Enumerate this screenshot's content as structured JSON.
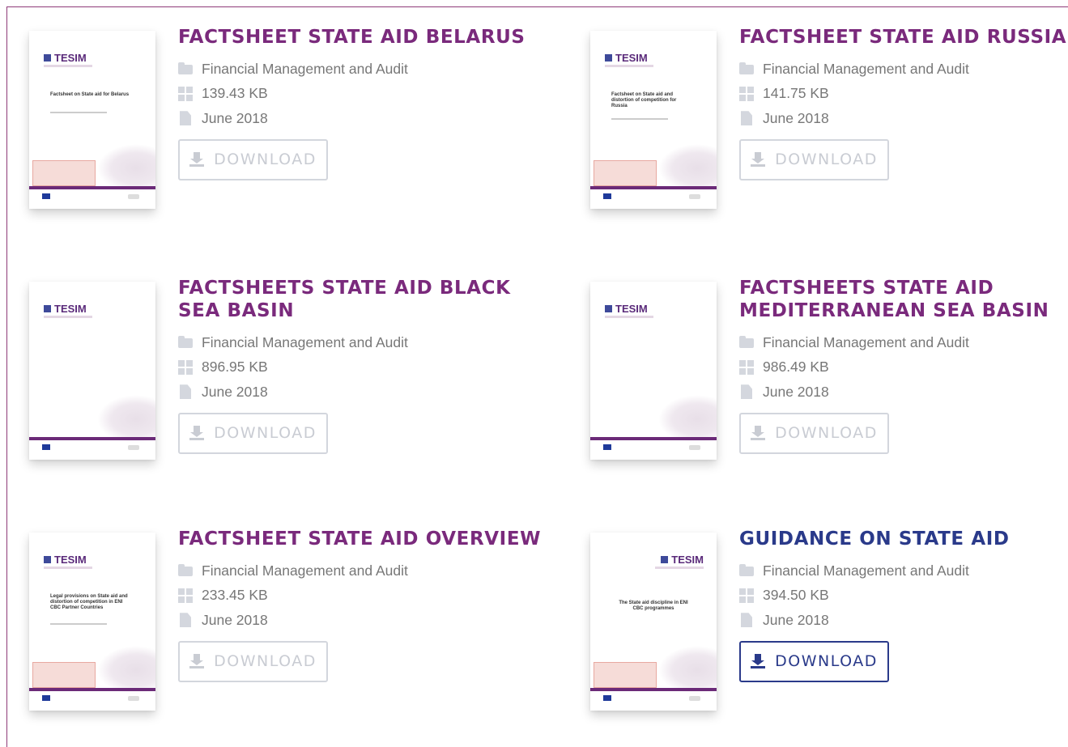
{
  "documents": [
    {
      "title": "FACTSHEET STATE AID BELARUS",
      "category": "Financial Management and Audit",
      "size": "139.43 KB",
      "date": "June 2018",
      "download_label": "DOWNLOAD",
      "thumb_logo": "TESIM",
      "thumb_title": "Factsheet on State aid for Belarus"
    },
    {
      "title": "FACTSHEET STATE AID RUSSIA",
      "category": "Financial Management and Audit",
      "size": "141.75 KB",
      "date": "June 2018",
      "download_label": "DOWNLOAD",
      "thumb_logo": "TESIM",
      "thumb_title": "Factsheet on State aid and distortion of competition for Russia"
    },
    {
      "title": "FACTSHEETS STATE AID BLACK SEA BASIN",
      "category": "Financial Management and Audit",
      "size": "896.95 KB",
      "date": "June 2018",
      "download_label": "DOWNLOAD",
      "thumb_logo": "TESIM",
      "thumb_title": ""
    },
    {
      "title": "FACTSHEETS STATE AID MEDITERRANEAN SEA BASIN",
      "category": "Financial Management and Audit",
      "size": "986.49 KB",
      "date": "June 2018",
      "download_label": "DOWNLOAD",
      "thumb_logo": "TESIM",
      "thumb_title": ""
    },
    {
      "title": "FACTSHEET STATE AID OVERVIEW",
      "category": "Financial Management and Audit",
      "size": "233.45 KB",
      "date": "June 2018",
      "download_label": "DOWNLOAD",
      "thumb_logo": "TESIM",
      "thumb_title": "Legal provisions on State aid and distortion of competition in ENI CBC Partner Countries"
    },
    {
      "title": "GUIDANCE ON STATE AID",
      "category": "Financial Management and Audit",
      "size": "394.50 KB",
      "date": "June 2018",
      "download_label": "DOWNLOAD",
      "thumb_logo": "TESIM",
      "thumb_title": "The State aid discipline in ENI CBC programmes"
    }
  ],
  "colors": {
    "title_purple": "#7a2a7c",
    "title_blue": "#2a3a8a",
    "frame_border": "#8e3a78",
    "button_inactive": "#d3d6dd",
    "button_active": "#2a3a8a",
    "meta_text": "#777777",
    "meta_icon": "#d4d7de"
  },
  "icons": {
    "category": "folder-icon",
    "size": "grid-icon",
    "date": "file-icon",
    "download": "download-icon"
  }
}
